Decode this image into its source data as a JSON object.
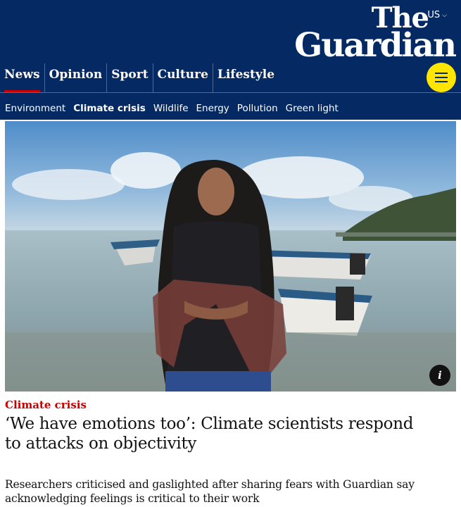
{
  "header": {
    "edition_label": "US",
    "logo_line1": "The",
    "logo_line2": "Guardian",
    "colors": {
      "brand": "#052962",
      "accent": "#c70000",
      "menu": "#ffe500"
    }
  },
  "pillars": [
    {
      "label": "News",
      "active": true
    },
    {
      "label": "Opinion",
      "active": false
    },
    {
      "label": "Sport",
      "active": false
    },
    {
      "label": "Culture",
      "active": false
    },
    {
      "label": "Lifestyle",
      "active": false
    }
  ],
  "menu_icon": "hamburger-icon",
  "subnav": [
    {
      "label": "Environment",
      "active": false
    },
    {
      "label": "Climate crisis",
      "active": true
    },
    {
      "label": "Wildlife",
      "active": false
    },
    {
      "label": "Energy",
      "active": false
    },
    {
      "label": "Pollution",
      "active": false
    },
    {
      "label": "Green light",
      "active": false
    }
  ],
  "hero": {
    "info_label": "i"
  },
  "article": {
    "kicker": "Climate crisis",
    "headline": "‘We have emotions too’: Climate scientists respond to attacks on objectivity",
    "standfirst": "Researchers criticised and gaslighted after sharing fears with Guardian say acknowledging feelings is critical to their work"
  }
}
